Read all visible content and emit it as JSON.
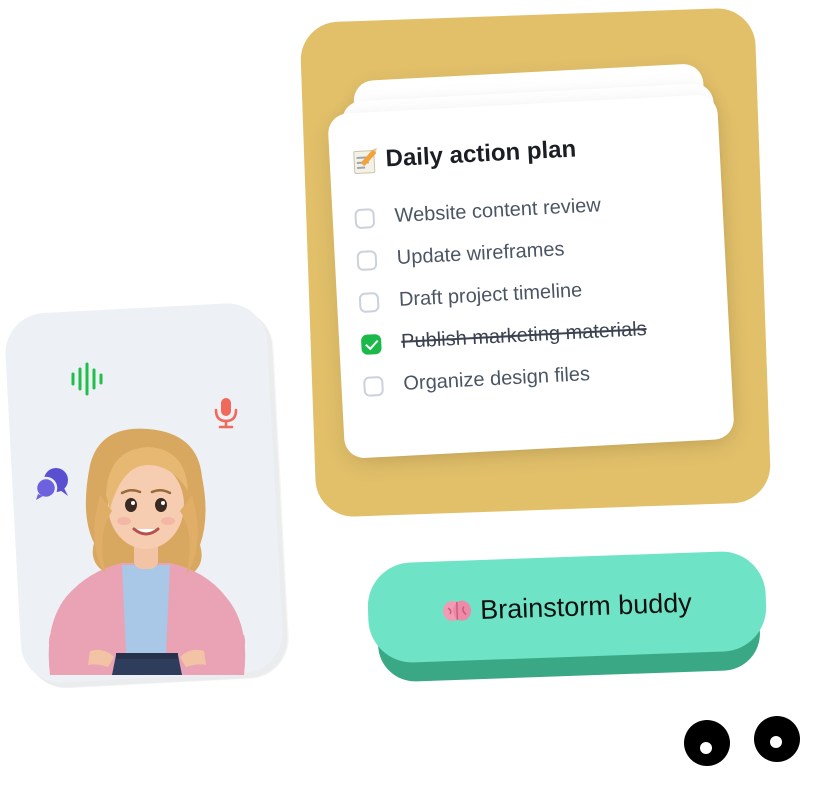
{
  "checklist": {
    "title": "Daily action plan",
    "title_icon": "memo-icon",
    "tasks": [
      {
        "label": "Website content review",
        "checked": false
      },
      {
        "label": "Update wireframes",
        "checked": false
      },
      {
        "label": "Draft project timeline",
        "checked": false
      },
      {
        "label": "Publish marketing materials",
        "checked": true
      },
      {
        "label": "Organize design files",
        "checked": false
      }
    ]
  },
  "assistant": {
    "icons": [
      "waveform-icon",
      "microphone-icon",
      "chat-bubbles-icon"
    ],
    "icon_colors": {
      "waveform": "#1fbf4a",
      "microphone": "#ef6a5a",
      "chat": "#5b4fd1"
    }
  },
  "brainstorm": {
    "label": "Brainstorm buddy",
    "icon": "brain-icon",
    "color": "#6ee3c6"
  },
  "colors": {
    "yellow_card": "#e2c06a",
    "check_green": "#1bb84a"
  }
}
